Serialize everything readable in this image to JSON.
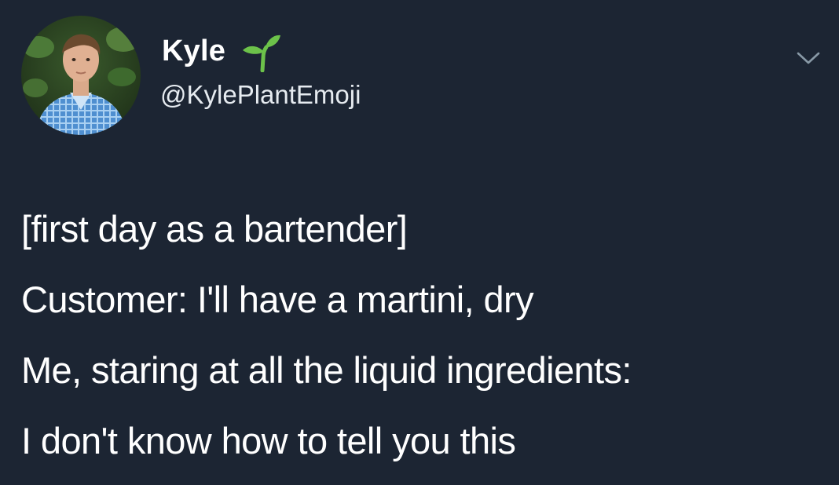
{
  "tweet": {
    "author": {
      "display_name": "Kyle",
      "name_emoji_icon": "seedling-icon",
      "handle": "@KylePlantEmoji",
      "avatar_icon": "profile-photo"
    },
    "menu_icon": "chevron-down-icon",
    "lines": [
      "[first day as a bartender]",
      "Customer: I'll have a martini, dry",
      "Me, staring at all the liquid ingredients:",
      "I don't know how to tell you this"
    ]
  },
  "colors": {
    "background": "#1c2533",
    "text": "#ffffff",
    "seedling": "#6cc24a",
    "chevron": "#8899a6"
  }
}
